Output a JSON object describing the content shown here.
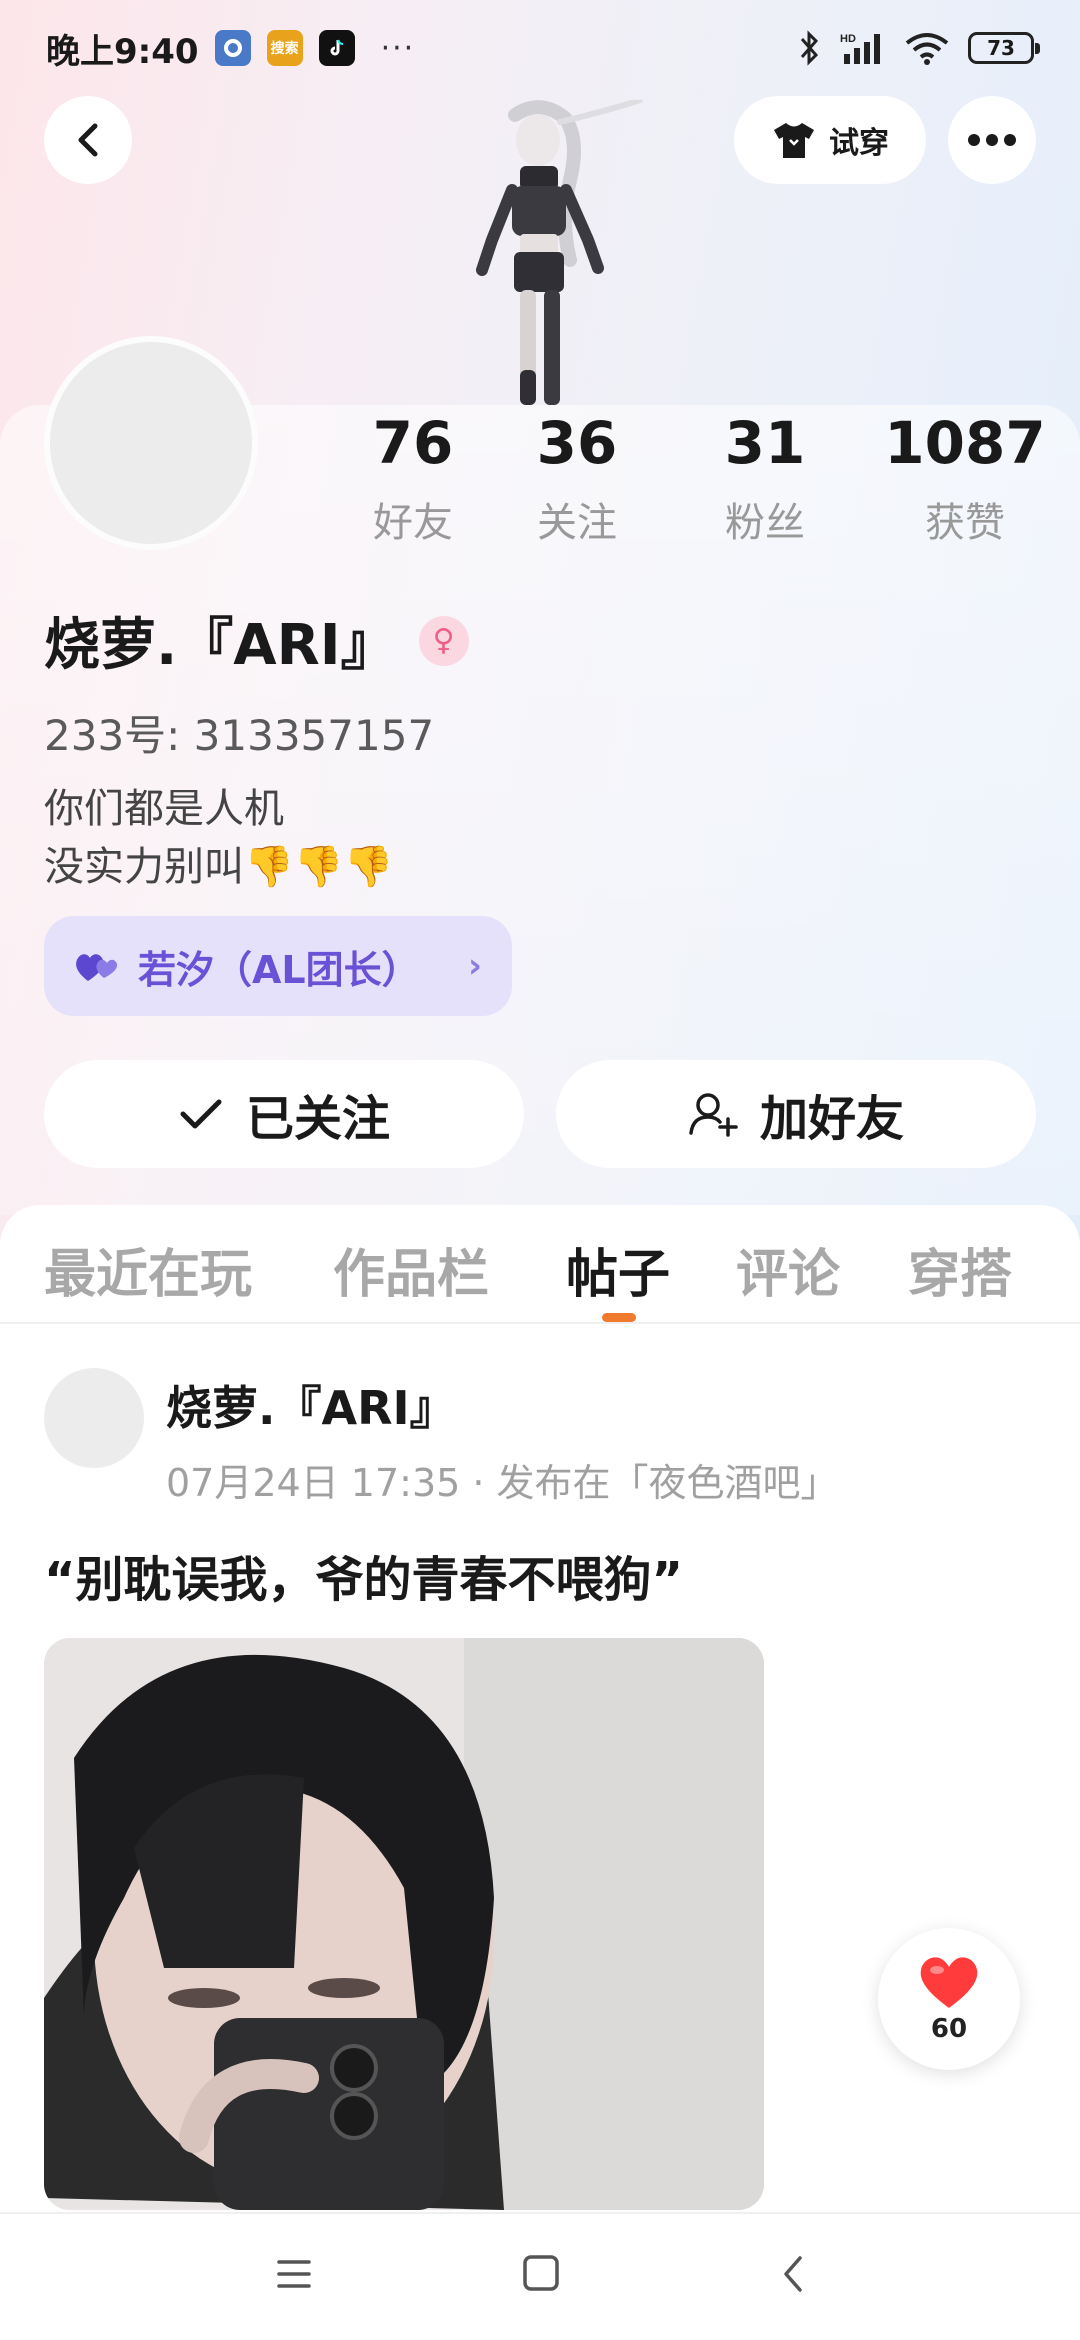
{
  "status_bar": {
    "time": "晚上9:40",
    "app_icon_1": "gear-app-icon",
    "app_icon_2_label": "搜索",
    "app_icon_3": "tiktok-icon",
    "overflow": "···",
    "battery": "73"
  },
  "header": {
    "back_icon": "chevron-left-icon",
    "try_on_label": "试穿",
    "more_icon": "more-dots-icon"
  },
  "profile": {
    "stats": [
      {
        "value": "76",
        "label": "好友"
      },
      {
        "value": "36",
        "label": "关注"
      },
      {
        "value": "31",
        "label": "粉丝"
      },
      {
        "value": "1087",
        "label": "获赞"
      }
    ],
    "name": "烧萝.『ARI』",
    "gender_icon": "female-icon",
    "uid": "233号: 313357157",
    "bio_line1": "你们都是人机",
    "bio_line2": "没实力别叫",
    "bio_emoji": "👎👎👎",
    "group": {
      "label": "若汐（AL团长）",
      "icon": "heart-pair-icon",
      "chevron": "›"
    },
    "actions": {
      "followed_label": "已关注",
      "add_friend_label": "加好友"
    }
  },
  "tabs": [
    {
      "label": "最近在玩",
      "active": false
    },
    {
      "label": "作品栏",
      "active": false
    },
    {
      "label": "帖子",
      "active": true
    },
    {
      "label": "评论",
      "active": false
    },
    {
      "label": "穿搭",
      "active": false
    }
  ],
  "post": {
    "author": "烧萝.『ARI』",
    "meta": "07月24日 17:35 · 发布在「夜色酒吧」",
    "text": "“别耽误我，爷的青春不喂狗”",
    "likes": "60"
  },
  "colors": {
    "accent_orange": "#f07a2e",
    "group_purple": "#6a52d7",
    "like_red": "#ff3b3b"
  }
}
